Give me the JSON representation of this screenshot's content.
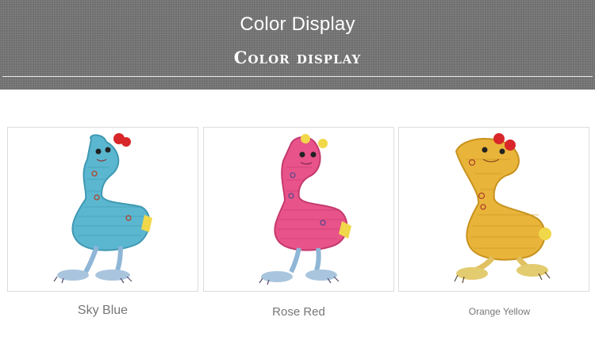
{
  "header": {
    "title": "Color Display",
    "subtitle": "Color display"
  },
  "products": [
    {
      "label": "Sky Blue",
      "body_color": "#5bb7d0",
      "shade_color": "#3f98b2"
    },
    {
      "label": "Rose Red",
      "body_color": "#e8538a",
      "shade_color": "#c53a6e"
    },
    {
      "label": "Orange Yellow",
      "body_color": "#e8b43a",
      "shade_color": "#c8921e"
    }
  ],
  "colors": {
    "banner_bg": "#6f6f6f",
    "caption_text": "#777777",
    "card_border": "#dcdcdc"
  }
}
